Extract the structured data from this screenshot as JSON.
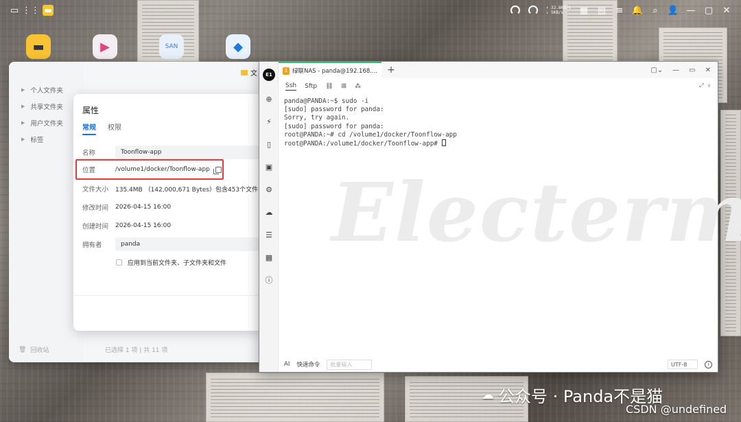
{
  "topbar": {
    "net_up": "↑ 32.8KB/s",
    "net_down": "↓ 5KB/s",
    "cpu_label": "CPU",
    "ram_label": "RAM"
  },
  "file_manager": {
    "title": "文",
    "sidebar": [
      {
        "label": "个人文件夹"
      },
      {
        "label": "共享文件夹"
      },
      {
        "label": "用户文件夹"
      },
      {
        "label": "标签"
      }
    ],
    "trash_label": "回收站",
    "status": "已选择 1 项 | 共 11 项"
  },
  "properties": {
    "title": "属性",
    "tabs": [
      "常规",
      "权限"
    ],
    "name_label": "名称",
    "name_value": "Toonflow-app",
    "location_label": "位置",
    "location_value": "/volume1/docker/Toonflow-app",
    "size_label": "文件大小",
    "size_value": "135.4MB （142,000,671 Bytes）包含453个文件,",
    "modified_label": "修改时间",
    "modified_value": "2026-04-15 16:00",
    "created_label": "创建时间",
    "created_value": "2026-04-15 16:00",
    "owner_label": "拥有者",
    "owner_value": "panda",
    "apply_label": "应用到当前文件夹、子文件夹和文件"
  },
  "terminal": {
    "logo": "E1",
    "tab_number": "1",
    "tab_title": "绿联NAS - panda@192.168....",
    "sub_tabs": [
      "Ssh",
      "Sftp"
    ],
    "lines": [
      "panda@PANDA:~$ sudo -i",
      "[sudo] password for panda:",
      "Sorry, try again.",
      "[sudo] password for panda:",
      "root@PANDA:~# cd /volume1/docker/Toonflow-app",
      "root@PANDA:/volume1/docker/Toonflow-app# "
    ],
    "watermark": "Electerm",
    "bottom_ai": "AI",
    "bottom_quick": "快速命令",
    "batch_placeholder": "批量输入",
    "encoding": "UTF-8"
  },
  "footer": {
    "wechat": "公众号 · Panda不是猫",
    "csdn": "CSDN @undefined"
  }
}
